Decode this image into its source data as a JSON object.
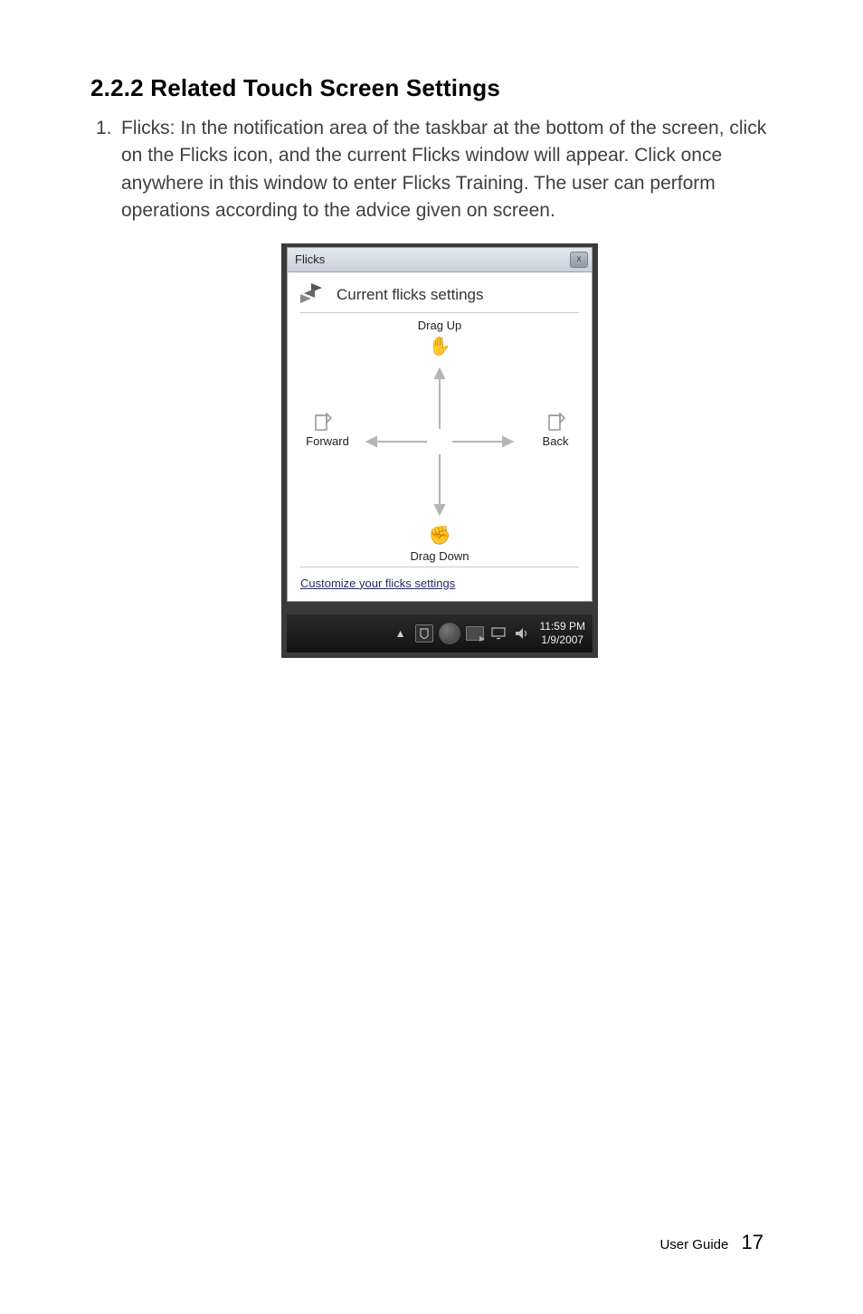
{
  "heading": "2.2.2 Related Touch Screen Settings",
  "list_number": "1.",
  "body": "Flicks: In the notification area of the taskbar at the bottom of the screen, click on the Flicks icon, and the current Flicks window will appear. Click once anywhere in this window to enter Flicks Training. The user can perform operations according to the advice given on screen.",
  "window": {
    "title": "Flicks",
    "close": "x",
    "header": "Current flicks settings",
    "labels": {
      "up": "Drag Up",
      "down": "Drag Down",
      "left": "Forward",
      "right": "Back"
    },
    "customize": "Customize your flicks settings"
  },
  "taskbar": {
    "time": "11:59 PM",
    "date": "1/9/2007"
  },
  "footer": {
    "label": "User Guide",
    "page": "17"
  }
}
